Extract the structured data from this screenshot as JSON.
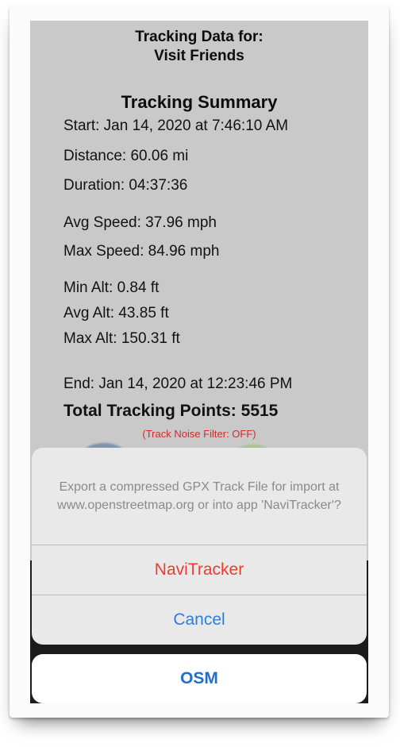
{
  "header": {
    "line1": "Tracking Data for:",
    "line2": "Visit Friends"
  },
  "summary": {
    "title": "Tracking Summary",
    "start": "Start: Jan 14, 2020 at 7:46:10 AM",
    "distance": "Distance:  60.06 mi",
    "duration": "Duration: 04:37:36",
    "avg_speed": "Avg Speed:  37.96 mph",
    "max_speed": "Max Speed:  84.96 mph",
    "min_alt": "Min Alt:   0.84 ft",
    "avg_alt": "Avg Alt:  43.85 ft",
    "max_alt": "Max Alt: 150.31 ft",
    "end": "End: Jan 14, 2020 at 12:23:46 PM",
    "total_points": "Total Tracking Points: 5515",
    "noise_filter": "(Track Noise Filter: OFF)"
  },
  "action_sheet": {
    "message": "Export a compressed GPX Track File for import at www.openstreetmap.org or into app 'NaviTracker'?",
    "navitracker_label": "NaviTracker",
    "cancel_label": "Cancel",
    "osm_label": "OSM"
  },
  "colors": {
    "destructive_red": "#ef3b30",
    "action_blue": "#2c7de0",
    "sheet_bg": "#e9e9e9",
    "screen_bg": "#c9c9c9"
  }
}
